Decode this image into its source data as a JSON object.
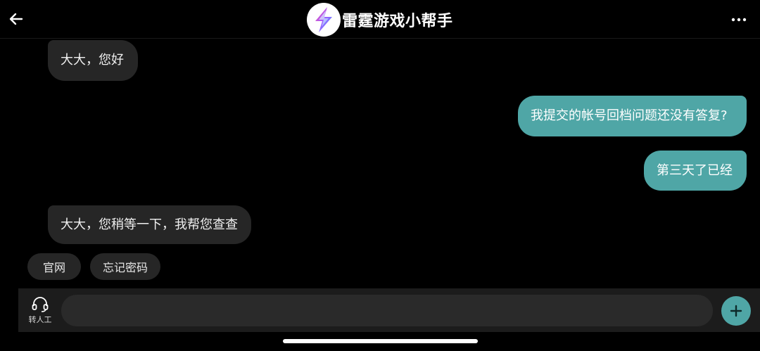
{
  "header": {
    "title": "雷霆游戏小帮手",
    "back_icon": "arrow-left-icon",
    "more_icon": "more-horizontal-icon",
    "logo_icon": "thunder-logo-icon"
  },
  "messages": [
    {
      "side": "incoming",
      "text": "大大，您好"
    },
    {
      "side": "outgoing",
      "text": "我提交的帐号回档问题还没有答复?"
    },
    {
      "side": "outgoing",
      "text": "第三天了已经"
    },
    {
      "side": "incoming",
      "text": "大大，您稍等一下，我帮您查查"
    }
  ],
  "quick_replies": [
    {
      "label": "官网"
    },
    {
      "label": "忘记密码"
    }
  ],
  "input_bar": {
    "agent_label": "转人工",
    "agent_icon": "headset-icon",
    "input_value": "",
    "placeholder": "",
    "plus_icon": "plus-icon"
  },
  "colors": {
    "background": "#000000",
    "incoming_bubble": "#262626",
    "outgoing_bubble": "#4fa6a6",
    "accent": "#4fa6a6",
    "input_bar": "#1c1c1c"
  }
}
